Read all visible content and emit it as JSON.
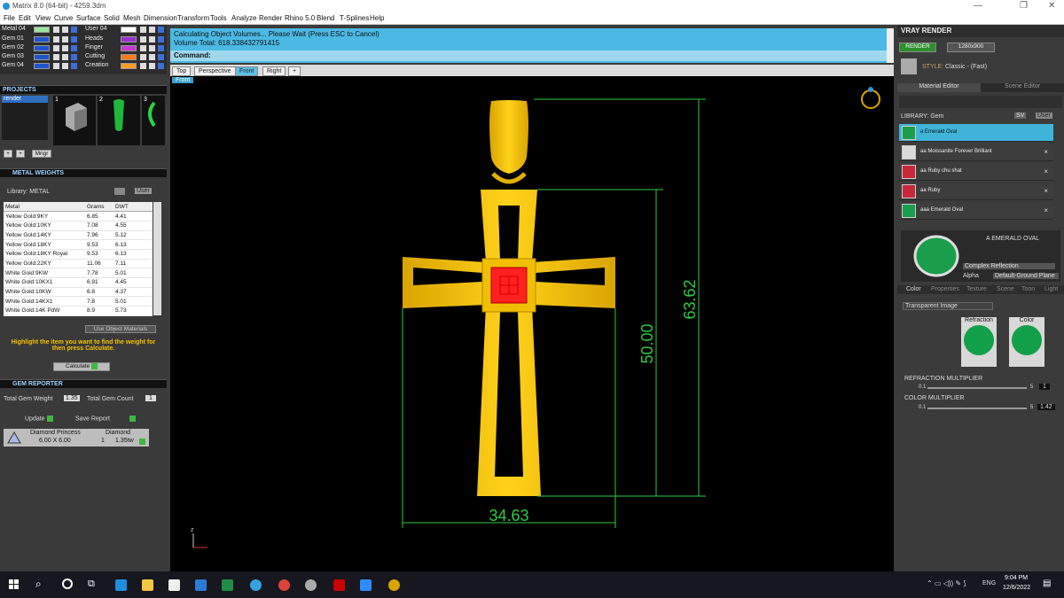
{
  "window": {
    "title": "Matrix 8.0 (64-bit) - 4259.3dm",
    "min": "—",
    "restore": "❐",
    "close": "✕"
  },
  "menu": [
    "File",
    "Edit",
    "View",
    "Curve",
    "Surface",
    "Solid",
    "Mesh",
    "Dimension",
    "Transform",
    "Tools",
    "Analyze",
    "Render",
    "Rhino 5.0",
    "Blend",
    "T-Splines",
    "Help"
  ],
  "layers": {
    "left": [
      {
        "name": "Metal 04",
        "color": "#9fe39f"
      },
      {
        "name": "Gem 01",
        "color": "#2255cc"
      },
      {
        "name": "Gem 02",
        "color": "#2255cc"
      },
      {
        "name": "Gem 03",
        "color": "#2255cc"
      },
      {
        "name": "Gem 04",
        "color": "#2255cc"
      }
    ],
    "right": [
      {
        "name": "User 04",
        "color": "#ffffff"
      },
      {
        "name": "Heads",
        "color": "#9b2fd0"
      },
      {
        "name": "Finger",
        "color": "#c83ad0"
      },
      {
        "name": "Cutting",
        "color": "#ff7a1a"
      },
      {
        "name": "Creation",
        "color": "#ff9b2a"
      }
    ]
  },
  "projects": {
    "title": "PROJECTS",
    "item": "render",
    "thumbs": [
      "1",
      "2",
      "3"
    ],
    "mngr": "Mngr"
  },
  "metal_weights": {
    "title": "METAL WEIGHTS",
    "library_label": "Library: METAL",
    "user": "User",
    "columns": [
      "Metal",
      "Grams",
      "DWT"
    ],
    "rows": [
      [
        "Yellow Gold:9KY",
        "6.85",
        "4.41"
      ],
      [
        "Yellow Gold:10KY",
        "7.08",
        "4.55"
      ],
      [
        "Yellow Gold:14KY",
        "7.96",
        "5.12"
      ],
      [
        "Yellow Gold:18KY",
        "9.53",
        "6.13"
      ],
      [
        "Yellow Gold:18KY Royal",
        "9.53",
        "6.13"
      ],
      [
        "Yellow Gold:22KY",
        "11.06",
        "7.11"
      ],
      [
        "White Gold:9KW",
        "7.78",
        "5.01"
      ],
      [
        "White Gold:10KX1",
        "6.91",
        "4.45"
      ],
      [
        "White Gold:10KW",
        "6.8",
        "4.37"
      ],
      [
        "White Gold:14KX1",
        "7.8",
        "5.01"
      ],
      [
        "White Gold:14K PdW",
        "8.9",
        "5.73"
      ]
    ],
    "use_object_materials": "Use Object Materials",
    "hint": "Highlight the item you want to find the weight for then press Calculate.",
    "calculate": "Calculate"
  },
  "gem_reporter": {
    "title": "GEM REPORTER",
    "total_weight_label": "Total Gem Weight",
    "total_weight": "1.35",
    "total_count_label": "Total Gem Count",
    "total_count": "1",
    "update": "Update",
    "save_report": "Save Report",
    "gem": {
      "name": "Diamond Princess",
      "size": "6.00 X 6.00",
      "material": "Diamond",
      "count": "1",
      "weight": "1.35tw"
    }
  },
  "command": {
    "line1": "Calculating Object Volumes... Please Wait (Press ESC to Cancel)",
    "line2": "Volume Total: 618.338432791415",
    "prompt": "Command:"
  },
  "viewport": {
    "tabs": [
      "Top",
      "Perspective",
      "Front",
      "Right"
    ],
    "active_tab": "Front",
    "label": "Front",
    "dims": {
      "width": "34.63",
      "height_inner": "50.00",
      "height_outer": "63.62"
    },
    "axis": "z"
  },
  "vray": {
    "title": "VRAY RENDER",
    "render": "RENDER",
    "resolution": "1280x900",
    "style_label": "STYLE:",
    "style": "Classic - (Fast)",
    "tabs": [
      "Material Editor",
      "Scene Editor"
    ],
    "library_label": "LIBRARY: Gem",
    "sv": "SV",
    "user": "User",
    "materials": [
      {
        "name": "a Emerald Oval",
        "color": "#1b9e4b",
        "selected": true
      },
      {
        "name": "aa Moissanite Forever Brilliant",
        "color": "#d9d9d9",
        "selected": false
      },
      {
        "name": "aa Ruby chu shat",
        "color": "#c8283a",
        "selected": false
      },
      {
        "name": "aa Ruby",
        "color": "#c8283a",
        "selected": false
      },
      {
        "name": "aaa Emerald Oval",
        "color": "#1b9e4b",
        "selected": false
      }
    ],
    "preview_name": "A EMERALD OVAL",
    "reflection": "Complex Reflection",
    "alpha": "Alpha",
    "ground": "Default-Ground Plane",
    "prop_tabs": [
      "Color",
      "Properties",
      "Texture",
      "Scene",
      "Toon",
      "Light"
    ],
    "image_mode": "Transparent Image",
    "refraction": "Refraction",
    "color": "Color",
    "refraction_mult_label": "REFRACTION MULTIPLIER",
    "refraction_mult_min": "0.1",
    "refraction_mult_max": "5",
    "refraction_mult": "1",
    "color_mult_label": "COLOR MULTIPLIER",
    "color_mult_min": "0.1",
    "color_mult_max": "5",
    "color_mult": "1.42"
  },
  "taskbar": {
    "lang": "ENG",
    "time": "9:04 PM",
    "date": "12/6/2022"
  }
}
